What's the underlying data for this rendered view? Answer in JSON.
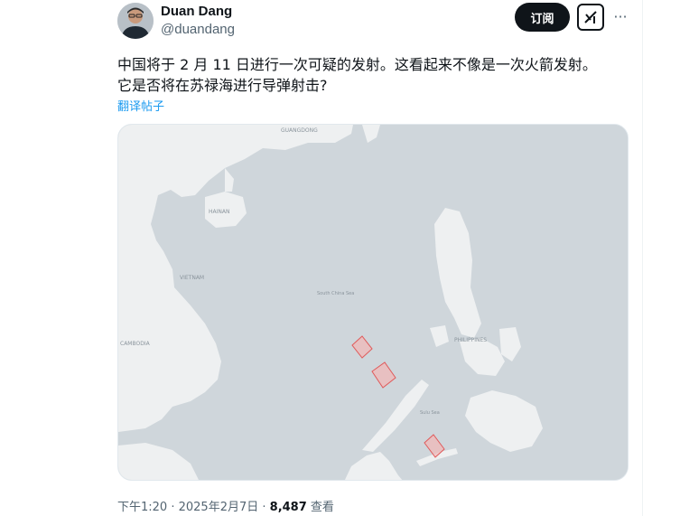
{
  "author": {
    "name": "Duan Dang",
    "handle": "@duandang"
  },
  "actions": {
    "follow_label": "订阅",
    "more_label": "···"
  },
  "tweet": {
    "line1": "中国将于 2 月 11 日进行一次可疑的发射。这看起来不像是一次火箭发射。",
    "line2": "它是否将在苏禄海进行导弹射击?",
    "translate_label": "翻译帖子"
  },
  "map": {
    "labels": {
      "guangdong": "GUANGDONG",
      "hainan": "HAINAN",
      "vietnam": "VIETNAM",
      "cambodia": "CAMBODIA",
      "philippines": "PHILIPPINES",
      "south_china_sea": "South China Sea",
      "sulu_sea": "Sulu Sea"
    },
    "colors": {
      "water": "#cfd6db",
      "land": "#eef0f1",
      "zone_fill": "#f2b6b6",
      "zone_stroke": "#e05a5a"
    }
  },
  "meta": {
    "time": "下午1:20",
    "date": "2025年2月7日",
    "views_count": "8,487",
    "views_label": "查看"
  },
  "icons": {
    "grok": "grok-icon",
    "more": "more-icon",
    "avatar": "avatar"
  }
}
